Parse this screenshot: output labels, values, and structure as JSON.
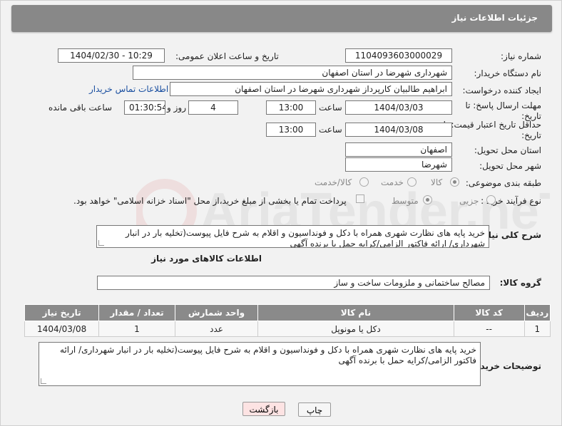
{
  "header": {
    "title": "جزئیات اطلاعات نیاز"
  },
  "fields": {
    "need_number_label": "شماره نیاز:",
    "need_number": "1104093603000029",
    "announce_label": "تاریخ و ساعت اعلان عمومی:",
    "announce_value": "1404/02/30 - 10:29",
    "buyer_org_label": "نام دستگاه خریدار:",
    "buyer_org": "شهرداری شهرضا در استان اصفهان",
    "creator_label": "ایجاد کننده درخواست:",
    "creator": "ابراهیم طالبیان کارپرداز شهرداری شهرضا در استان اصفهان",
    "contact_link": "اطلاعات تماس خریدار",
    "reply_deadline_label": "مهلت ارسال پاسخ: تا تاریخ:",
    "reply_date": "1404/03/03",
    "time_label": "ساعت",
    "reply_time": "13:00",
    "days_value": "4",
    "days_label": "روز و",
    "remaining_value": "01:30:54",
    "remaining_label": "ساعت باقی مانده",
    "price_valid_label": "حداقل تاریخ اعتبار قیمت: تا تاریخ:",
    "price_date": "1404/03/08",
    "price_time": "13:00",
    "province_label": "استان محل تحویل:",
    "province": "اصفهان",
    "city_label": "شهر محل تحویل:",
    "city": "شهرضا",
    "category_label": "طبقه بندی موضوعی:",
    "category_options": [
      "کالا",
      "خدمت",
      "کالا/خدمت"
    ],
    "process_label": "نوع فرآیند خرید :",
    "process_options": [
      "جزیی",
      "متوسط"
    ],
    "payment_note": "پرداخت تمام یا بخشی از مبلغ خرید،از محل \"اسناد خزانه اسلامی\" خواهد بود."
  },
  "description": {
    "label": "شرح کلی نیاز:",
    "text": "خرید پایه های نظارت شهری همراه با دکل و فونداسیون و اقلام به شرح فایل پیوست(تخلیه بار در انبار شهرداری/ ارائه فاکتور الزامی/کرایه حمل با برنده آگهی"
  },
  "goods": {
    "section_title": "اطلاعات کالاهای مورد نیاز",
    "group_label": "گروه کالا:",
    "group_value": "مصالح ساختمانی و ملزومات ساخت و ساز",
    "columns": [
      "ردیف",
      "کد کالا",
      "نام کالا",
      "واحد شمارش",
      "تعداد / مقدار",
      "تاریخ نیاز"
    ],
    "rows": [
      [
        "1",
        "--",
        "دکل یا مونوپل",
        "عدد",
        "1",
        "1404/03/08"
      ]
    ]
  },
  "buyer_notes": {
    "label": "توضیحات خریدار:",
    "text": "خرید پایه های نظارت شهری همراه با دکل و فونداسیون و اقلام به شرح فایل پیوست(تخلیه بار در انبار شهرداری/ ارائه فاکتور الزامی/کرایه حمل با برنده آگهی"
  },
  "buttons": {
    "print": "چاپ",
    "back": "بازگشت"
  },
  "watermark": {
    "text": "AriaTender.neT"
  }
}
